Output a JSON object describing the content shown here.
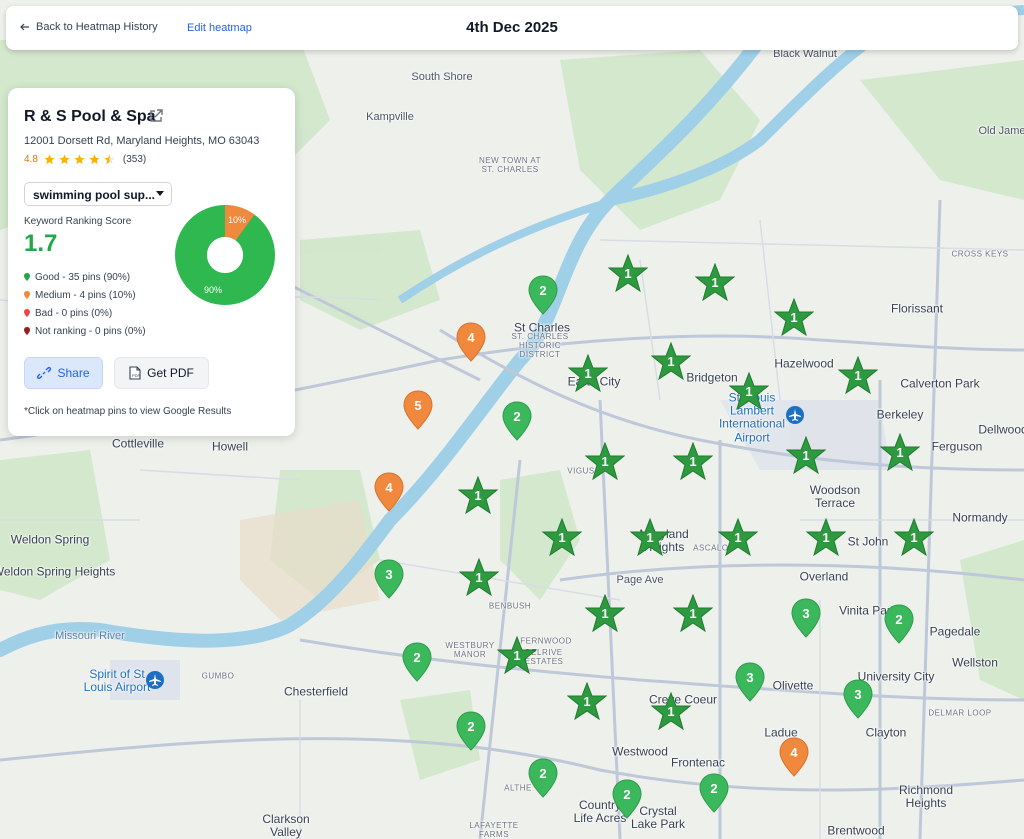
{
  "topbar": {
    "back_label": "Back to Heatmap History",
    "edit_label": "Edit heatmap",
    "date": "4th Dec 2025"
  },
  "business": {
    "name": "R & S Pool & Spa",
    "address": "12001 Dorsett Rd, Maryland Heights, MO 63043",
    "rating": "4.8",
    "review_count": "(353)",
    "stars_filled": 4.5
  },
  "keyword": {
    "selected": "swimming pool sup..."
  },
  "score": {
    "label": "Keyword Ranking Score",
    "value": "1.7"
  },
  "legend": [
    {
      "label": "Good - 35 pins (90%)",
      "color": "#22a74a"
    },
    {
      "label": "Medium - 4 pins (10%)",
      "color": "#f0883e"
    },
    {
      "label": "Bad - 0 pins (0%)",
      "color": "#ef4444"
    },
    {
      "label": "Not ranking - 0 pins (0%)",
      "color": "#991b1b"
    }
  ],
  "donut": {
    "good_pct": 90,
    "medium_pct": 10,
    "good_label": "90%",
    "medium_label": "10%",
    "good_color": "#2eb84f",
    "medium_color": "#f0883e"
  },
  "buttons": {
    "share": "Share",
    "pdf": "Get PDF"
  },
  "note": "*Click on heatmap pins to view Google Results",
  "colors": {
    "star_pin": "#2d9a3f",
    "good_pin": "#3cb85c",
    "medium_pin": "#f0883e"
  },
  "map_labels": {
    "south_shore": "South Shore",
    "kampville": "Kampville",
    "black_walnut": "Black Walnut",
    "old_jame": "Old Jame",
    "new_town": "NEW TOWN AT ST. CHARLES",
    "florissant": "Florissant",
    "cross_keys": "CROSS KEYS",
    "st_charles": "St Charles",
    "historic_district": "ST. CHARLES HISTORIC DISTRICT",
    "hazelwood": "Hazelwood",
    "bridgeton": "Bridgeton",
    "earth_city": "Earth City",
    "calverton_park": "Calverton Park",
    "berkeley": "Berkeley",
    "st_louis_airport": "St. Louis Lambert International Airport",
    "ferguson": "Ferguson",
    "dellwood": "Dellwood",
    "cottleville": "Cottleville",
    "howell": "Howell",
    "vigus": "VIGUS",
    "woodson_terrace": "Woodson Terrace",
    "normandy": "Normandy",
    "maryland_heights": "Maryland Heights",
    "st_john": "St John",
    "weldon_spring": "Weldon Spring",
    "weldon_spring_heights": "Weldon Spring Heights",
    "ascalon": "ASCALON",
    "overland": "Overland",
    "page_ave": "Page Ave",
    "benbush": "BENBUSH",
    "vinita_park": "Vinita Park",
    "pagedale": "Pagedale",
    "missouri_river": "Missouri River",
    "westbury_manor": "WESTBURY MANOR",
    "fernwood": "FERNWOOD",
    "belrive_estates": "BELRIVE ESTATES",
    "wellston": "Wellston",
    "spirit_airport": "Spirit of St Louis Airport",
    "gumbo": "GUMBO",
    "chesterfield": "Chesterfield",
    "creve_coeur": "Creve Coeur",
    "olivette": "Olivette",
    "university_city": "University City",
    "delmar_loop": "DELMAR LOOP",
    "ladue": "Ladue",
    "clayton": "Clayton",
    "westwood": "Westwood",
    "frontenac": "Frontenac",
    "althea": "ALTHE",
    "country_life_acres": "Country Life Acres",
    "crystal_lake_park": "Crystal Lake Park",
    "richmond_heights": "Richmond Heights",
    "clarkson_valley": "Clarkson Valley",
    "lafayette_farms": "LAFAYETTE FARMS",
    "brentwood": "Brentwood"
  },
  "pins": [
    {
      "type": "star",
      "rank": "1"
    },
    {
      "type": "star",
      "rank": "1"
    },
    {
      "type": "star",
      "rank": "1"
    },
    {
      "type": "star",
      "rank": "1"
    },
    {
      "type": "star",
      "rank": "1"
    },
    {
      "type": "star",
      "rank": "1"
    },
    {
      "type": "star",
      "rank": "1"
    },
    {
      "type": "star",
      "rank": "1"
    },
    {
      "type": "star",
      "rank": "1"
    },
    {
      "type": "star",
      "rank": "1"
    },
    {
      "type": "star",
      "rank": "1"
    },
    {
      "type": "star",
      "rank": "1"
    },
    {
      "type": "star",
      "rank": "1"
    },
    {
      "type": "star",
      "rank": "1"
    },
    {
      "type": "star",
      "rank": "1"
    },
    {
      "type": "star",
      "rank": "1"
    },
    {
      "type": "star",
      "rank": "1"
    },
    {
      "type": "star",
      "rank": "1"
    },
    {
      "type": "star",
      "rank": "1"
    },
    {
      "type": "star",
      "rank": "1"
    },
    {
      "type": "star",
      "rank": "1"
    },
    {
      "type": "star",
      "rank": "1"
    },
    {
      "type": "star",
      "rank": "1"
    },
    {
      "type": "star",
      "rank": "1"
    },
    {
      "type": "drop",
      "rank": "2",
      "level": "good"
    },
    {
      "type": "drop",
      "rank": "2",
      "level": "good"
    },
    {
      "type": "drop",
      "rank": "2",
      "level": "good"
    },
    {
      "type": "drop",
      "rank": "2",
      "level": "good"
    },
    {
      "type": "drop",
      "rank": "2",
      "level": "good"
    },
    {
      "type": "drop",
      "rank": "2",
      "level": "good"
    },
    {
      "type": "drop",
      "rank": "2",
      "level": "good"
    },
    {
      "type": "drop",
      "rank": "2",
      "level": "good"
    },
    {
      "type": "drop",
      "rank": "3",
      "level": "good"
    },
    {
      "type": "drop",
      "rank": "3",
      "level": "good"
    },
    {
      "type": "drop",
      "rank": "3",
      "level": "good"
    },
    {
      "type": "drop",
      "rank": "3",
      "level": "good"
    },
    {
      "type": "drop",
      "rank": "4",
      "level": "medium"
    },
    {
      "type": "drop",
      "rank": "5",
      "level": "medium"
    },
    {
      "type": "drop",
      "rank": "4",
      "level": "medium"
    },
    {
      "type": "drop",
      "rank": "4",
      "level": "medium"
    }
  ]
}
